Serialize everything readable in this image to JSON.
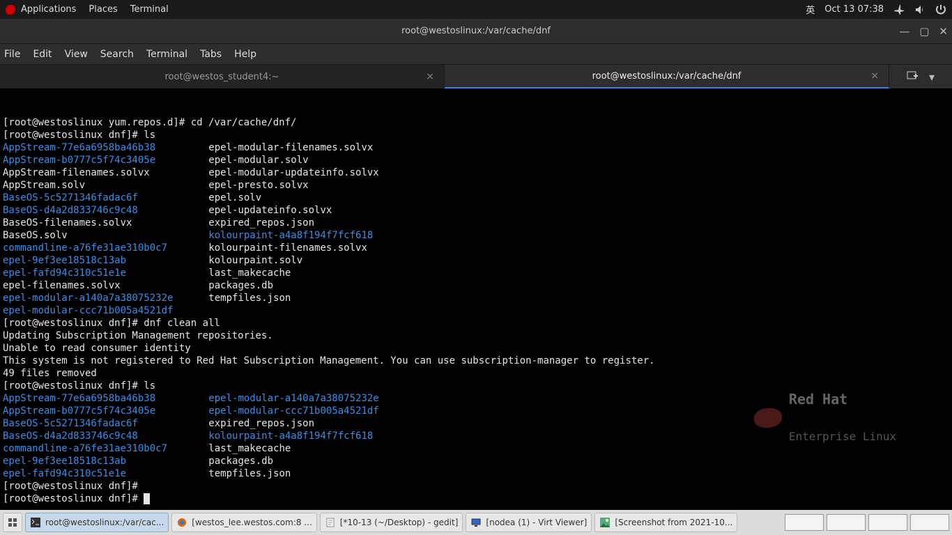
{
  "topbar": {
    "apps": "Applications",
    "places": "Places",
    "terminal": "Terminal",
    "ime": "英",
    "clock": "Oct 13  07:38"
  },
  "window": {
    "title": "root@westoslinux:/var/cache/dnf"
  },
  "menubar": {
    "file": "File",
    "edit": "Edit",
    "view": "View",
    "search": "Search",
    "terminal": "Terminal",
    "tabs": "Tabs",
    "help": "Help"
  },
  "tabs": {
    "t0": "root@westos_student4:~",
    "t1": "root@westoslinux:/var/cache/dnf"
  },
  "watermark": {
    "line1": "Red Hat",
    "line2": "Enterprise Linux"
  },
  "term": {
    "l1": "[root@westoslinux yum.repos.d]# cd /var/cache/dnf/",
    "l2": "[root@westoslinux dnf]# ls",
    "ls1": [
      {
        "a": "AppStream-77e6a6958ba46b38",
        "ad": true,
        "b": "epel-modular-filenames.solvx",
        "bd": false
      },
      {
        "a": "AppStream-b0777c5f74c3405e",
        "ad": true,
        "b": "epel-modular.solv",
        "bd": false
      },
      {
        "a": "AppStream-filenames.solvx",
        "ad": false,
        "b": "epel-modular-updateinfo.solvx",
        "bd": false
      },
      {
        "a": "AppStream.solv",
        "ad": false,
        "b": "epel-presto.solvx",
        "bd": false
      },
      {
        "a": "BaseOS-5c5271346fadac6f",
        "ad": true,
        "b": "epel.solv",
        "bd": false
      },
      {
        "a": "BaseOS-d4a2d833746c9c48",
        "ad": true,
        "b": "epel-updateinfo.solvx",
        "bd": false
      },
      {
        "a": "BaseOS-filenames.solvx",
        "ad": false,
        "b": "expired_repos.json",
        "bd": false
      },
      {
        "a": "BaseOS.solv",
        "ad": false,
        "b": "kolourpaint-a4a8f194f7fcf618",
        "bd": true
      },
      {
        "a": "commandline-a76fe31ae310b0c7",
        "ad": true,
        "b": "kolourpaint-filenames.solvx",
        "bd": false
      },
      {
        "a": "epel-9ef3ee18518c13ab",
        "ad": true,
        "b": "kolourpaint.solv",
        "bd": false
      },
      {
        "a": "epel-fafd94c310c51e1e",
        "ad": true,
        "b": "last_makecache",
        "bd": false
      },
      {
        "a": "epel-filenames.solvx",
        "ad": false,
        "b": "packages.db",
        "bd": false
      },
      {
        "a": "epel-modular-a140a7a38075232e",
        "ad": true,
        "b": "tempfiles.json",
        "bd": false
      },
      {
        "a": "epel-modular-ccc71b005a4521df",
        "ad": true,
        "b": "",
        "bd": false
      }
    ],
    "l3": "[root@westoslinux dnf]# dnf clean all",
    "l4": "Updating Subscription Management repositories.",
    "l5": "Unable to read consumer identity",
    "l6": "This system is not registered to Red Hat Subscription Management. You can use subscription-manager to register.",
    "l7": "49 files removed",
    "l8": "[root@westoslinux dnf]# ls",
    "ls2": [
      {
        "a": "AppStream-77e6a6958ba46b38",
        "ad": true,
        "b": "epel-modular-a140a7a38075232e",
        "bd": true
      },
      {
        "a": "AppStream-b0777c5f74c3405e",
        "ad": true,
        "b": "epel-modular-ccc71b005a4521df",
        "bd": true
      },
      {
        "a": "BaseOS-5c5271346fadac6f",
        "ad": true,
        "b": "expired_repos.json",
        "bd": false
      },
      {
        "a": "BaseOS-d4a2d833746c9c48",
        "ad": true,
        "b": "kolourpaint-a4a8f194f7fcf618",
        "bd": true
      },
      {
        "a": "commandline-a76fe31ae310b0c7",
        "ad": true,
        "b": "last_makecache",
        "bd": false
      },
      {
        "a": "epel-9ef3ee18518c13ab",
        "ad": true,
        "b": "packages.db",
        "bd": false
      },
      {
        "a": "epel-fafd94c310c51e1e",
        "ad": true,
        "b": "tempfiles.json",
        "bd": false
      }
    ],
    "l9": "[root@westoslinux dnf]#",
    "l10": "[root@westoslinux dnf]# "
  },
  "taskbar": {
    "t0": "root@westoslinux:/var/cac...",
    "t1": "[westos_lee.westos.com:8 ...",
    "t2": "[*10-13 (~/Desktop) - gedit]",
    "t3": "[nodea (1) - Virt Viewer]",
    "t4": "[Screenshot from 2021-10..."
  }
}
